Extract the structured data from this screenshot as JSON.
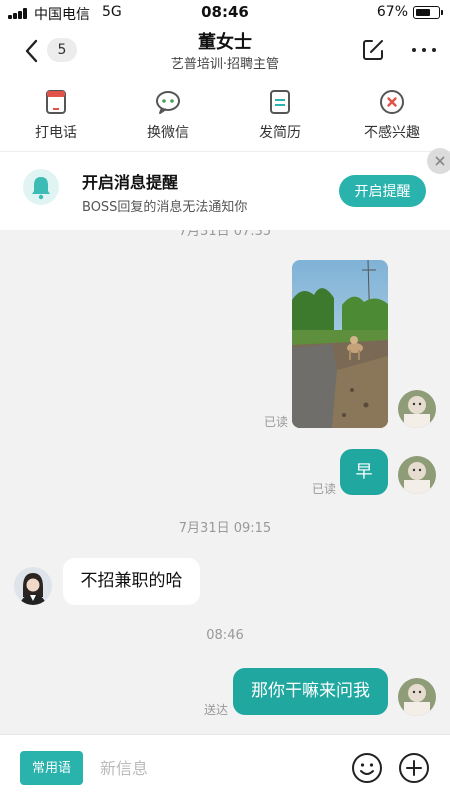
{
  "status_bar": {
    "carrier": "中国电信",
    "network": "5G",
    "time": "08:46",
    "battery_percent": "67%",
    "battery_level": 0.67
  },
  "header": {
    "unread_count": "5",
    "contact_name": "董女士",
    "contact_subtitle": "艺普培训·招聘主管",
    "icons": [
      "back-icon",
      "edit-icon",
      "more-icon"
    ]
  },
  "actions": [
    {
      "label": "打电话",
      "icon": "phone-icon",
      "color": "#e0534a"
    },
    {
      "label": "换微信",
      "icon": "wechat-icon",
      "color": "#4aa05a"
    },
    {
      "label": "发简历",
      "icon": "resume-icon",
      "color": "#2ab3ad"
    },
    {
      "label": "不感兴趣",
      "icon": "not-interested-icon",
      "color": "#e0534a"
    }
  ],
  "notice": {
    "title": "开启消息提醒",
    "description": "BOSS回复的消息无法通知你",
    "button_label": "开启提醒",
    "accent": "#2ab3ad"
  },
  "chat": {
    "top_timestamp_partial": "7月31日 07:35",
    "messages": [
      {
        "type": "image",
        "direction": "out",
        "status": "已读",
        "content": "photo of a dog on a path"
      },
      {
        "type": "text",
        "direction": "out",
        "text": "早",
        "status": "已读"
      },
      {
        "type": "timestamp",
        "text": "7月31日 09:15"
      },
      {
        "type": "text",
        "direction": "in",
        "text": "不招兼职的哈"
      },
      {
        "type": "timestamp",
        "text": "08:46"
      },
      {
        "type": "text",
        "direction": "out",
        "text": "那你干嘛来问我",
        "status": "送达"
      }
    ],
    "bubble_color": "#1fa7a0"
  },
  "bottom_bar": {
    "phrases_label": "常用语",
    "input_placeholder": "新信息",
    "icons": [
      "emoji-icon",
      "plus-icon"
    ]
  }
}
